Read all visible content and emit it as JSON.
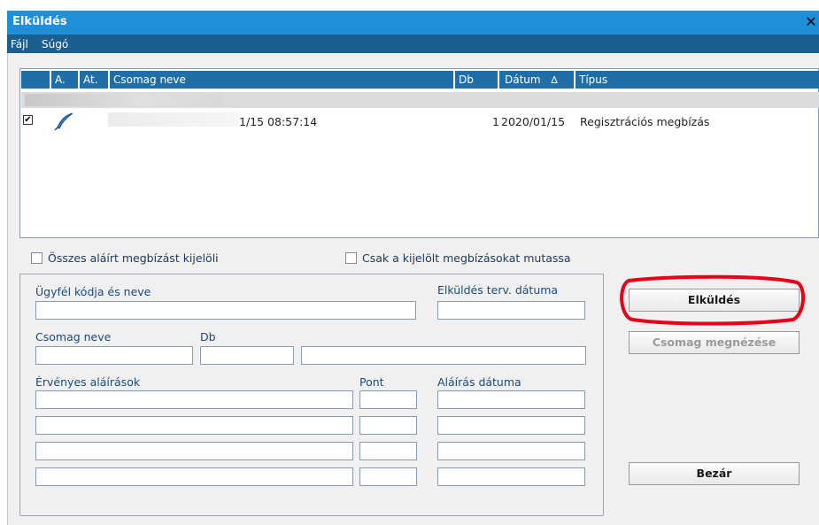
{
  "window": {
    "title": "Elküldés",
    "close_glyph": "✕"
  },
  "menu": [
    "Fájl",
    "Súgó"
  ],
  "grid": {
    "columns": [
      "A.",
      "At.",
      "Csomag neve",
      "Db",
      "Dátum",
      "Típus"
    ],
    "sort_indicator": "∆",
    "row": {
      "checked_glyph": "✔",
      "icon": "feather-pen-icon",
      "csomag_neve_visible": "1/15 08:57:14",
      "db": "1",
      "datum": "2020/01/15",
      "tipus": "Regisztrációs megbízás"
    }
  },
  "options": {
    "select_all_label": "Összes aláírt megbízást kijelöli",
    "show_selected_label": "Csak a kijelölt megbízásokat mutassa"
  },
  "form": {
    "client_label": "Ügyfél kódja és neve",
    "send_date_label": "Elküldés terv. dátuma",
    "package_name_label": "Csomag neve",
    "db_label": "Db",
    "valid_signatures_label": "Érvényes aláírások",
    "pont_label": "Pont",
    "sign_date_label": "Aláírás dátuma"
  },
  "buttons": {
    "send": "Elküldés",
    "view_package": "Csomag megnézése",
    "close": "Bezár"
  },
  "colors": {
    "title_bar": "#1f8fd8",
    "menu_bar": "#1a5f8f",
    "grid_header": "#1f6ea8",
    "highlight": "#e8001a"
  }
}
